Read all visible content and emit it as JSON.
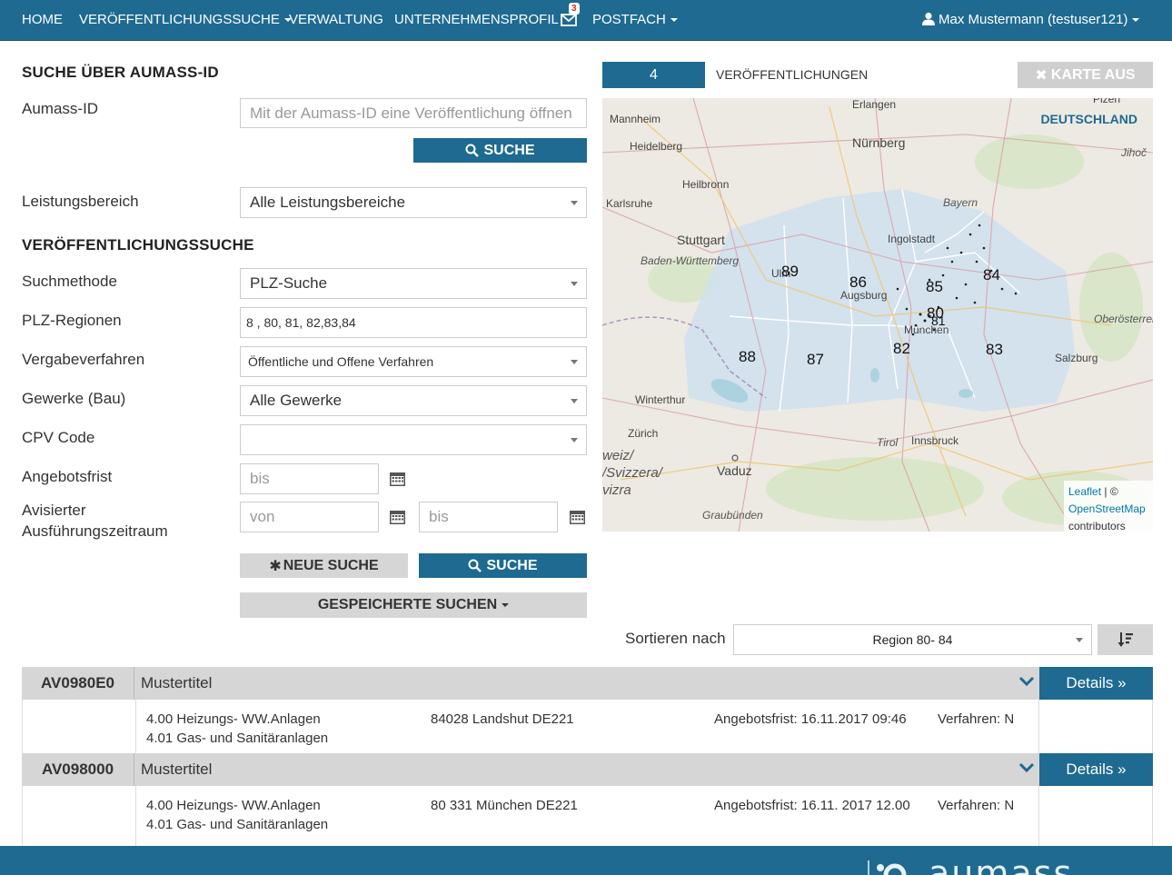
{
  "nav": {
    "home": "HOME",
    "publication_search": "VERÖFFENTLICHUNGSSUCHE",
    "administration": "VERWALTUNG",
    "company_profile": "UNTERNEHMENSPROFIL",
    "mail_count": "3",
    "mailbox": "POSTFACH",
    "user": "Max Mustermann (testuser121)"
  },
  "aumass_search": {
    "title": "SUCHE ÜBER AUMASS-ID",
    "id_label": "Aumass-ID",
    "id_placeholder": "Mit der Aumass-ID eine Veröffentlichung öffnen",
    "search_button": "SUCHE",
    "service_area_label": "Leistungsbereich",
    "service_area_value": "Alle Leistungsbereiche"
  },
  "publication_search": {
    "title": "VERÖFFENTLICHUNGSSUCHE",
    "method_label": "Suchmethode",
    "method_value": "PLZ-Suche",
    "plz_label": "PLZ-Regionen",
    "plz_value": "8 , 80, 81, 82,83,84",
    "procedure_label": "Vergabeverfahren",
    "procedure_value": "Öffentliche und Offene Verfahren",
    "trades_label": "Gewerke (Bau)",
    "trades_value": "Alle Gewerke",
    "cpv_label": "CPV Code",
    "cpv_value": "",
    "deadline_label": "Angebotsfrist",
    "deadline_placeholder": "bis",
    "period_label_1": "Avisierter",
    "period_label_2": "Ausführungszeitraum",
    "period_from_placeholder": "von",
    "period_to_placeholder": "bis",
    "new_search_button": "NEUE SUCHE",
    "search_button": "SUCHE",
    "saved_searches_button": "GESPEICHERTE SUCHEN"
  },
  "map": {
    "count": "4",
    "count_label": "VERÖFFENTLICHUNGEN",
    "map_off_button": "KARTE AUS",
    "country": "DEUTSCHLAND",
    "attribution_leaflet": "Leaflet",
    "attribution_sep": " | ©",
    "attribution_osm": "OpenStreetMap",
    "attribution_contrib": "contributors",
    "cities": [
      {
        "name": "Erlangen"
      },
      {
        "name": "Mannheim"
      },
      {
        "name": "Heidelberg"
      },
      {
        "name": "Nürnberg"
      },
      {
        "name": "Heilbronn"
      },
      {
        "name": "Karlsruhe"
      },
      {
        "name": "Bayern"
      },
      {
        "name": "Stuttgart"
      },
      {
        "name": "Ingolstadt"
      },
      {
        "name": "Baden-Württemberg"
      },
      {
        "name": "Ulm"
      },
      {
        "name": "Augsburg"
      },
      {
        "name": "München"
      },
      {
        "name": "Oberösterreich"
      },
      {
        "name": "Salzburg"
      },
      {
        "name": "Winterthur"
      },
      {
        "name": "Zürich"
      },
      {
        "name": "Tirol"
      },
      {
        "name": "Innsbruck"
      },
      {
        "name": "Vaduz"
      },
      {
        "name": "Graubünden"
      },
      {
        "name": "weiz/"
      },
      {
        "name": "/Svizzera/"
      },
      {
        "name": "vizra"
      },
      {
        "name": "Jihoč"
      },
      {
        "name": "Plzeň"
      }
    ],
    "region_numbers": [
      "89",
      "86",
      "85",
      "84",
      "80",
      "81",
      "82",
      "83",
      "88",
      "87"
    ]
  },
  "sort": {
    "label": "Sortieren nach",
    "value": "Region 80- 84"
  },
  "results": [
    {
      "id": "AV0980E0",
      "title": "Mustertitel",
      "trade_1": "4.00 Heizungs- WW.Anlagen",
      "trade_2": "4.01 Gas- und Sanitäranlagen",
      "location": "84028 Landshut DE221",
      "deadline": "Angebotsfrist: 16.11.2017 09:46",
      "procedure": "Verfahren: N",
      "details_button": "Details »"
    },
    {
      "id": "AV098000",
      "title": "Mustertitel",
      "trade_1": "4.00 Heizungs- WW.Anlagen",
      "trade_2": "4.01 Gas- und Sanitäranlagen",
      "location": "80 331 München DE221",
      "deadline": "Angebotsfrist: 16.11. 2017  12.00",
      "procedure": "Verfahren: N",
      "details_button": "Details »"
    }
  ],
  "footer": {
    "logo": "aumass"
  },
  "colors": {
    "primary": "#1e6a91",
    "button_gray": "#d6d6d6",
    "map_region": "#cfe0ef"
  }
}
